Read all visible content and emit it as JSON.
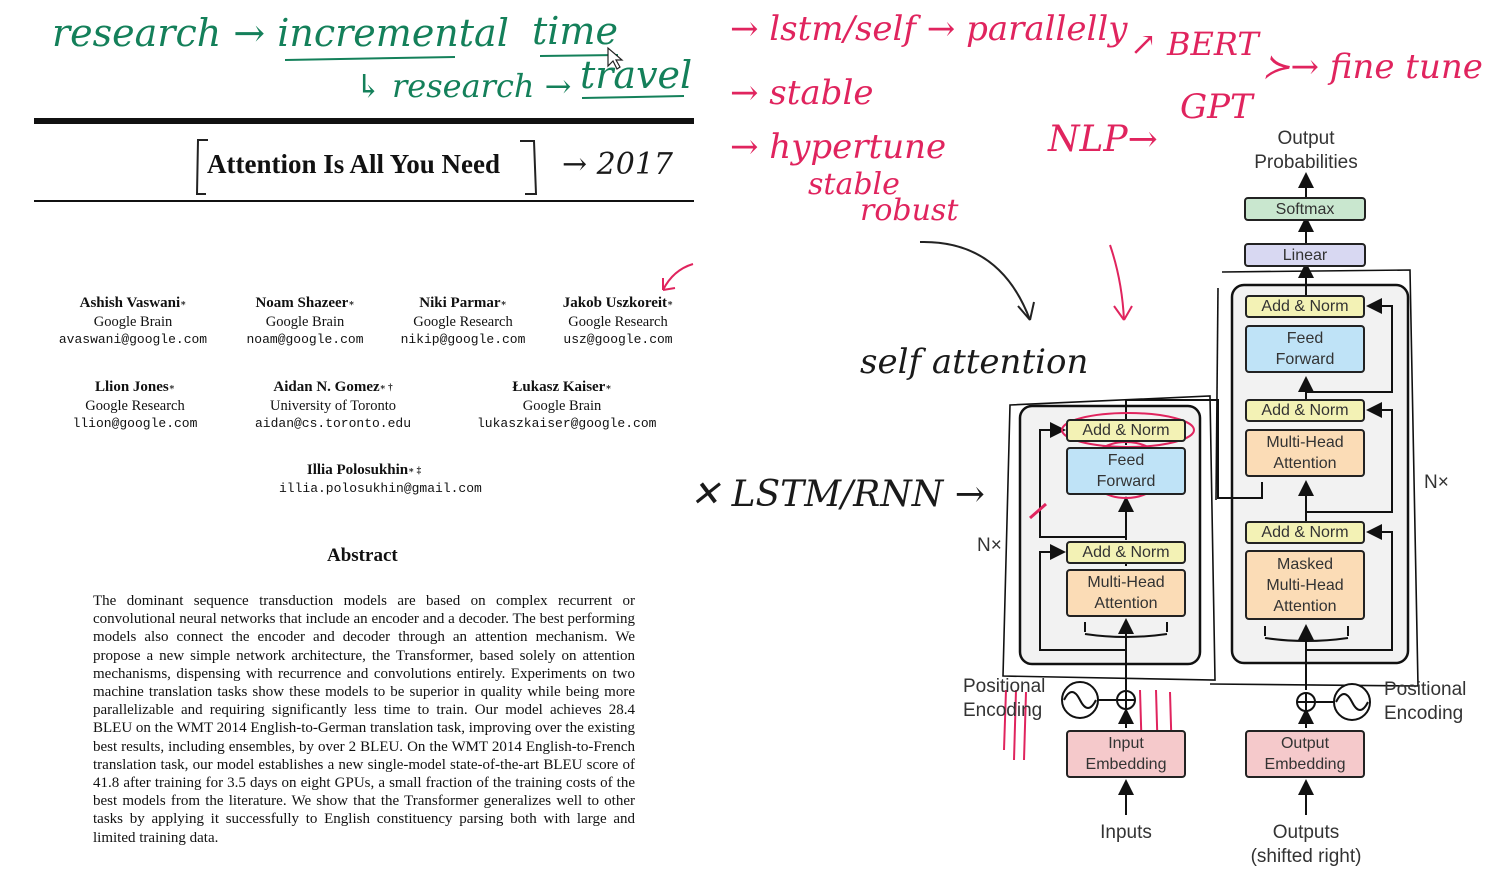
{
  "notes": {
    "top_left": "research → incremental",
    "top_left_sub": "↳ research →",
    "time": "time",
    "travel": "travel",
    "year": "→ 2017",
    "lstm_self": "→ lstm/self → parallelly",
    "stable": "→ stable",
    "hypertune": "→ hypertune",
    "stable2": "stable",
    "robust": "robust",
    "bert": "↗ BERT",
    "nlp": "NLP→",
    "gpt": "GPT",
    "finetune": "≻→ fine tune",
    "self_attention": "self attention",
    "lstm_rnn": "✕ LSTM/RNN →"
  },
  "paper": {
    "title": "Attention Is All You Need",
    "authors_row1": [
      {
        "name": "Ashish Vaswani",
        "mark": "∗",
        "affiliation": "Google Brain",
        "email": "avaswani@google.com"
      },
      {
        "name": "Noam Shazeer",
        "mark": "∗",
        "affiliation": "Google Brain",
        "email": "noam@google.com"
      },
      {
        "name": "Niki Parmar",
        "mark": "∗",
        "affiliation": "Google Research",
        "email": "nikip@google.com"
      },
      {
        "name": "Jakob Uszkoreit",
        "mark": "∗",
        "affiliation": "Google Research",
        "email": "usz@google.com"
      }
    ],
    "authors_row2": [
      {
        "name": "Llion Jones",
        "mark": "∗",
        "affiliation": "Google Research",
        "email": "llion@google.com"
      },
      {
        "name": "Aidan N. Gomez",
        "mark": "∗ †",
        "affiliation": "University of Toronto",
        "email": "aidan@cs.toronto.edu"
      },
      {
        "name": "Łukasz Kaiser",
        "mark": "∗",
        "affiliation": "Google Brain",
        "email": "lukaszkaiser@google.com"
      }
    ],
    "authors_row3": [
      {
        "name": "Illia Polosukhin",
        "mark": "∗ ‡",
        "email": "illia.polosukhin@gmail.com"
      }
    ],
    "abstract_title": "Abstract",
    "abstract": "The dominant sequence transduction models are based on complex recurrent or convolutional neural networks that include an encoder and a decoder. The best performing models also connect the encoder and decoder through an attention mechanism. We propose a new simple network architecture, the Transformer, based solely on attention mechanisms, dispensing with recurrence and convolutions entirely. Experiments on two machine translation tasks show these models to be superior in quality while being more parallelizable and requiring significantly less time to train. Our model achieves 28.4 BLEU on the WMT 2014 English-to-German translation task, improving over the existing best results, including ensembles, by over 2 BLEU. On the WMT 2014 English-to-French translation task, our model establishes a new single-model state-of-the-art BLEU score of 41.8 after training for 3.5 days on eight GPUs, a small fraction of the training costs of the best models from the literature. We show that the Transformer generalizes well to other tasks by applying it successfully to English constituency parsing both with large and limited training data."
  },
  "diagram": {
    "output_probabilities": [
      "Output",
      "Probabilities"
    ],
    "softmax": "Softmax",
    "linear": "Linear",
    "add_norm": "Add & Norm",
    "feed_forward": [
      "Feed",
      "Forward"
    ],
    "multi_head_attention": [
      "Multi-Head",
      "Attention"
    ],
    "masked_multi_head_attention": [
      "Masked",
      "Multi-Head",
      "Attention"
    ],
    "nx": "N×",
    "positional_encoding": [
      "Positional",
      "Encoding"
    ],
    "input_embedding": [
      "Input",
      "Embedding"
    ],
    "output_embedding": [
      "Output",
      "Embedding"
    ],
    "inputs": "Inputs",
    "outputs": [
      "Outputs",
      "(shifted right)"
    ]
  }
}
